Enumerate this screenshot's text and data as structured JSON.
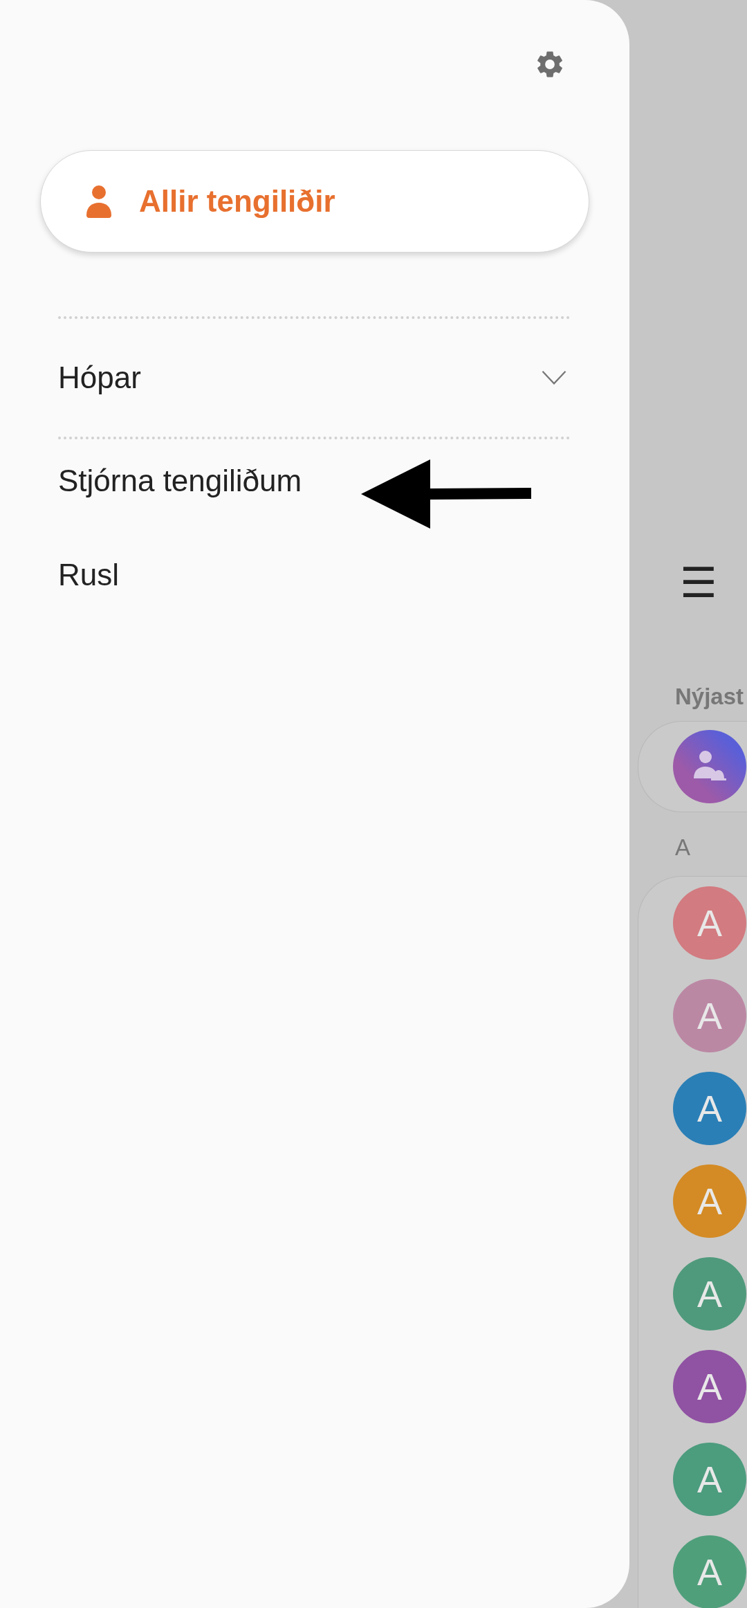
{
  "drawer": {
    "primary": {
      "label": "Allir tengiliðir",
      "selected": true
    },
    "items": [
      {
        "label": "Hópar",
        "kind": "expandable",
        "expanded": false
      },
      {
        "label": "Stjórna tengiliðum",
        "kind": "plain"
      },
      {
        "label": "Rusl",
        "kind": "plain"
      }
    ]
  },
  "background": {
    "menu_glyph": "☰",
    "section_recent": "Nýjast",
    "section_letter": "A",
    "contacts": [
      {
        "initial": "A",
        "color": "#d27b80"
      },
      {
        "initial": "A",
        "color": "#bb88a4"
      },
      {
        "initial": "A",
        "color": "#2a7fb6"
      },
      {
        "initial": "A",
        "color": "#d48b25"
      },
      {
        "initial": "A",
        "color": "#4f9a7c"
      },
      {
        "initial": "A",
        "color": "#9052a3"
      },
      {
        "initial": "A",
        "color": "#4c9c7e"
      },
      {
        "initial": "A",
        "color": "#4f9f7b"
      }
    ]
  }
}
